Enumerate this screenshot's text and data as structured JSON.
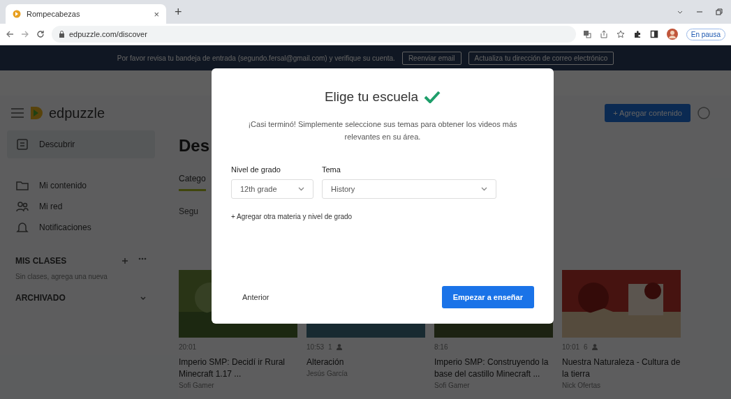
{
  "browser": {
    "tabs": [
      {
        "title": "Rompecabezas",
        "selected": true,
        "close": "×"
      }
    ],
    "new_tab": "+",
    "address": "edpuzzle.com/discover",
    "profile_label": "En pausa"
  },
  "banner": {
    "message": "Por favor revisa tu bandeja de entrada (segundo.fersal@gmail.com) y verifique su cuenta.",
    "buttons": [
      "Reenviar email",
      "Actualiza tu dirección de correo electrónico"
    ]
  },
  "header": {
    "logo": "edpuzzle",
    "add_button": "+ Agregar contenido"
  },
  "sidebar": {
    "items": [
      {
        "label": "Descubrir",
        "selected": true
      },
      {
        "label": "Mi contenido",
        "selected": false
      },
      {
        "label": "Mi red",
        "selected": false
      },
      {
        "label": "Notificaciones",
        "selected": false
      }
    ],
    "classes_title": "MIS CLASES",
    "classes_hint": "Sin clases, agrega una nueva",
    "archived_title": "ARCHIVADO"
  },
  "main": {
    "heading": "Des",
    "tabs": [
      {
        "label": "Catego",
        "selected": true
      }
    ],
    "filter": "Segu",
    "cards": [
      {
        "meta": "20:01",
        "title": "Imperio SMP: Decidí ir Rural Minecraft 1.17 ...",
        "channel": "Sofi Gamer"
      },
      {
        "meta": "10:53",
        "count": "1",
        "title": "Alteración",
        "channel": "Jesús García"
      },
      {
        "meta": "8:16",
        "title": "Imperio SMP: Construyendo la base del castillo Minecraft ...",
        "channel": "Sofi Gamer"
      },
      {
        "meta": "10:01",
        "count": "6",
        "title": "Nuestra Naturaleza - Cultura de la tierra",
        "channel": "Nick Ofertas"
      }
    ]
  },
  "modal": {
    "title": "Elige tu escuela",
    "description": "¡Casi terminó! Simplemente seleccione sus temas para obtener los videos más relevantes en su área.",
    "grade_label": "Nivel de grado",
    "grade_value": "12th grade",
    "subject_label": "Tema",
    "subject_value": "History",
    "add_link": "+ Agregar otra materia y nivel de grado",
    "back_button": "Anterior",
    "start_button": "Empezar a enseñar"
  }
}
